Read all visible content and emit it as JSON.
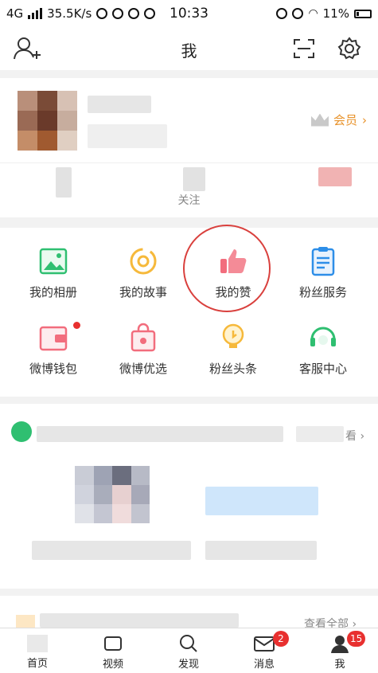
{
  "status_bar": {
    "network": "4G",
    "speed": "35.5K/s",
    "time": "10:33",
    "battery": "11%"
  },
  "header": {
    "title": "我"
  },
  "profile": {
    "vip_label": "会员",
    "follow_label": "关注"
  },
  "features": [
    {
      "label": "我的相册",
      "icon": "album-icon"
    },
    {
      "label": "我的故事",
      "icon": "story-icon"
    },
    {
      "label": "我的赞",
      "icon": "thumbs-up-icon"
    },
    {
      "label": "粉丝服务",
      "icon": "fan-service-icon"
    },
    {
      "label": "微博钱包",
      "icon": "wallet-icon"
    },
    {
      "label": "微博优选",
      "icon": "shopping-bag-icon"
    },
    {
      "label": "粉丝头条",
      "icon": "lightbulb-icon"
    },
    {
      "label": "客服中心",
      "icon": "headset-icon"
    }
  ],
  "section_more": {
    "partial": "看",
    "view_all": "查看全部"
  },
  "tabbar": {
    "home": "首页",
    "video": "视频",
    "discover": "发现",
    "messages": "消息",
    "messages_badge": "2",
    "me": "我",
    "me_badge": "15"
  },
  "colors": {
    "accent_red": "#e8302f",
    "vip_orange": "#e8922a",
    "highlight_ring": "#d9403d"
  }
}
